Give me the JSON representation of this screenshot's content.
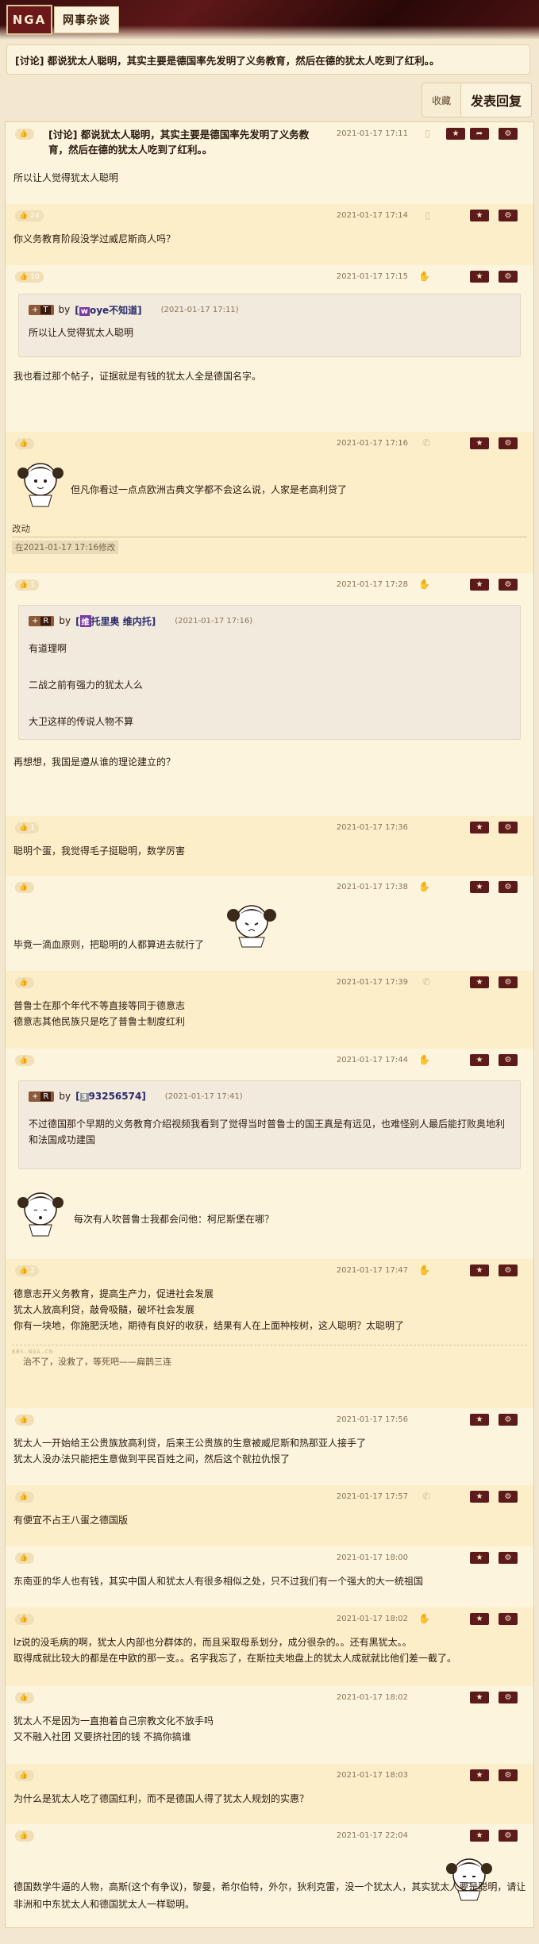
{
  "header": {
    "logo": "NGA",
    "breadcrumb": "网事杂谈"
  },
  "thread": {
    "title": "[讨论] 都说犹太人聪明，其实主要是德国率先发明了义务教育，然后在德的犹太人吃到了红利。。",
    "favorite_label": "收藏",
    "reply_label": "发表回复"
  },
  "icons": {
    "favorite": "star-icon",
    "share": "share-icon",
    "settings": "gear-icon",
    "phone": "mobile-icon",
    "like": "thumbs-up-icon"
  },
  "colors": {
    "accent_dark": "#5c1a1a",
    "page_bg": "#f3e8cf",
    "post_bg_light": "#fcf4dd",
    "post_bg_alt": "#fbeec9"
  },
  "posts": [
    {
      "likes": "",
      "title": "[讨论] 都说犹太人聪明，其实主要是德国率先发明了义务教育，然后在德的犹太人吃到了红利。。",
      "date": "2021-01-17 17:11",
      "body": [
        "所以让人觉得犹太人聪明"
      ]
    },
    {
      "likes": "24",
      "date": "2021-01-17 17:14",
      "body": [
        "你义务教育阶段没学过威尼斯商人吗？"
      ]
    },
    {
      "likes": "10",
      "date": "2021-01-17 17:15",
      "quote": {
        "tag": "T",
        "by": "by",
        "name_icon": "w",
        "name": "oye不知道",
        "date": "(2021-01-17 17:11)",
        "text": [
          "所以让人觉得犹太人聪明"
        ]
      },
      "body": [
        "我也看过那个帖子，证据就是有钱的犹太人全是德国名字。"
      ]
    },
    {
      "likes": "",
      "date": "2021-01-17 17:16",
      "body": [
        "但凡你看过一点点欧洲古典文学都不会这么说，人家是老高利贷了"
      ],
      "edit_label": "改动",
      "edit_stamp": "在2021-01-17 17:16修改"
    },
    {
      "likes": "1",
      "date": "2021-01-17 17:28",
      "quote": {
        "tag": "R",
        "by": "by",
        "name_icon": "维",
        "name": "托里奥 维内托",
        "date": "(2021-01-17 17:16)",
        "text": [
          "有道理啊",
          "二战之前有强力的犹太人么",
          "大卫这样的传说人物不算"
        ]
      },
      "body": [
        "再想想，我国是遵从谁的理论建立的？"
      ]
    },
    {
      "likes": "1",
      "date": "2021-01-17 17:36",
      "body": [
        "聪明个蛋，我觉得毛子挺聪明，数学厉害"
      ]
    },
    {
      "likes": "",
      "date": "2021-01-17 17:38",
      "body": [
        "毕竟一滴血原则，把聪明的人都算进去就行了"
      ]
    },
    {
      "likes": "",
      "date": "2021-01-17 17:39",
      "body": [
        "普鲁士在那个年代不等直接等同于德意志",
        "德意志其他民族只是吃了普鲁士制度红利"
      ]
    },
    {
      "likes": "",
      "date": "2021-01-17 17:44",
      "quote": {
        "tag": "R",
        "by": "by",
        "name_icon": "",
        "name": "93256574",
        "date": "(2021-01-17 17:41)",
        "text": [
          "不过德国那个早期的义务教育介绍视频我看到了觉得当时普鲁士的国王真是有远见，也难怪别人最后能打败奥地利和法国成功建国"
        ]
      },
      "body": [
        "每次有人吹普鲁士我都会问他：柯尼斯堡在哪？"
      ]
    },
    {
      "likes": "2",
      "date": "2021-01-17 17:47",
      "body": [
        "德意志开义务教育，提高生产力，促进社会发展",
        "犹太人放高利贷，敲骨吸髓，破坏社会发展",
        "你有一块地，你施肥沃地，期待有良好的收获，结果有人在上面种桉树，这人聪明？太聪明了"
      ],
      "signature_watermark": "BBS.NGA.CN",
      "signature": "治不了，没救了，等死吧——扁鹊三连"
    },
    {
      "likes": "",
      "date": "2021-01-17 17:56",
      "body": [
        "犹太人一开始给王公贵族放高利贷，后来王公贵族的生意被威尼斯和热那亚人接手了",
        "犹太人没办法只能把生意做到平民百姓之间，然后这个就拉仇恨了"
      ]
    },
    {
      "likes": "",
      "date": "2021-01-17 17:57",
      "body": [
        "有便宜不占王八蛋之德国版"
      ]
    },
    {
      "likes": "",
      "date": "2021-01-17 18:00",
      "body": [
        "东南亚的华人也有钱，其实中国人和犹太人有很多相似之处，只不过我们有一个强大的大一统祖国"
      ]
    },
    {
      "likes": "",
      "date": "2021-01-17 18:02",
      "body": [
        "lz说的没毛病的啊，犹太人内部也分群体的，而且采取母系划分，成分很杂的。。还有黑犹太。。",
        "取得成就比较大的都是在中欧的那一支。。名字我忘了，在斯拉夫地盘上的犹太人成就就比他们差一截了。"
      ]
    },
    {
      "likes": "",
      "date": "2021-01-17 18:02",
      "body": [
        "犹太人不是因为一直抱着自己宗教文化不放手吗",
        "又不融入社团 又要挤社团的钱 不搞你搞谁"
      ]
    },
    {
      "likes": "",
      "date": "2021-01-17 18:03",
      "body": [
        "为什么是犹太人吃了德国红利，而不是德国人得了犹太人规划的实惠？"
      ]
    },
    {
      "likes": "",
      "date": "2021-01-17 22:04",
      "body": [
        "德国数学牛逼的人物，高斯(这个有争议)，黎曼，希尔伯特，外尔，狄利克雷，没一个犹太人，其实犹太人要是聪明，请让非洲和中东犹太人和德国犹太人一样聪明。"
      ]
    }
  ]
}
